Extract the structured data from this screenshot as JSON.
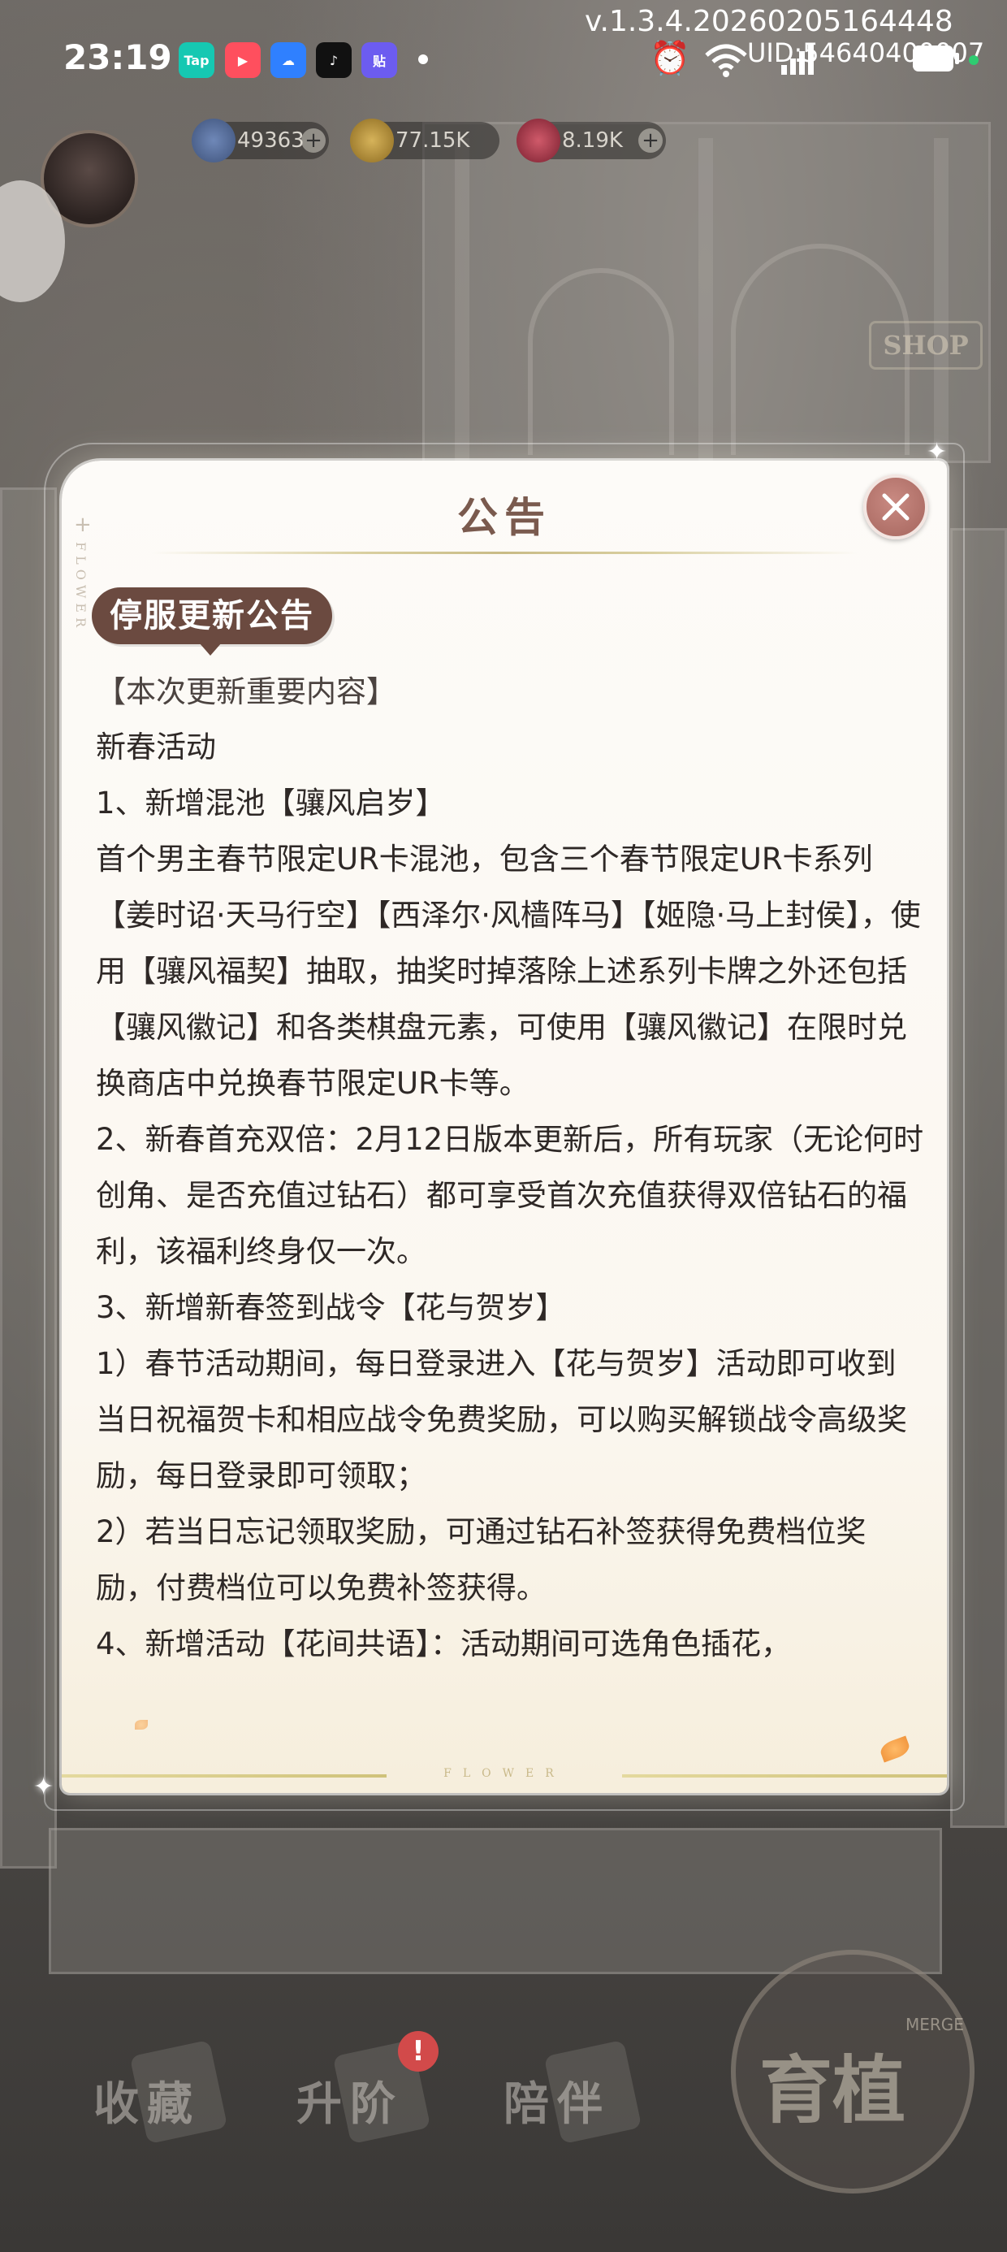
{
  "status_bar": {
    "time": "23:19",
    "version": "v.1.3.4.20260205164448",
    "uid": "UID:54640400007",
    "apps": [
      {
        "name": "taptap-icon",
        "label": "Tap",
        "color": "#16c8b2"
      },
      {
        "name": "video-app-icon",
        "label": "▶",
        "color": "#ff4f5e"
      },
      {
        "name": "cloud-app-icon",
        "label": "☁",
        "color": "#2f80ff"
      },
      {
        "name": "tiktok-icon",
        "label": "♪",
        "color": "#111111"
      },
      {
        "name": "tieba-icon",
        "label": "贴",
        "color": "#6c5cf0"
      }
    ]
  },
  "resources": {
    "energy": "49363",
    "gold": "77.15K",
    "gems": "8.19K"
  },
  "dialog": {
    "title": "公告",
    "side_decoration": "FLOWER",
    "section_tag": "停服更新公告",
    "bottom_decoration": "FLOWER",
    "paragraphs": [
      "【本次更新重要内容】",
      "新春活动",
      "1、新增混池【骧风启岁】",
      "首个男主春节限定UR卡混池，包含三个春节限定UR卡系列【姜时诏·天马行空】【西泽尔·风樯阵马】【姬隐·马上封侯】，使用【骧风福契】抽取，抽奖时掉落除上述系列卡牌之外还包括【骧风徽记】和各类棋盘元素，可使用【骧风徽记】在限时兑换商店中兑换春节限定UR卡等。",
      "2、新春首充双倍：2月12日版本更新后，所有玩家（无论何时创角、是否充值过钻石）都可享受首次充值获得双倍钻石的福利，该福利终身仅一次。",
      "3、新增新春签到战令【花与贺岁】",
      "1）春节活动期间，每日登录进入【花与贺岁】活动即可收到当日祝福贺卡和相应战令免费奖励，可以购买解锁战令高级奖励，每日登录即可领取；",
      "2）若当日忘记领取奖励，可通过钻石补签获得免费档位奖励，付费档位可以免费补签获得。",
      "4、新增活动【花间共语】：活动期间可选角色插花，"
    ]
  },
  "bottom_nav": {
    "collect": "收藏",
    "upgrade": "升阶",
    "accompany": "陪伴",
    "upgrade_badge": "!",
    "grow": "育植",
    "grow_sub": "MERGE",
    "shop": "SHOP"
  },
  "colors": {
    "accent_brown": "#6b4a40",
    "title_color": "#7a5a4e",
    "close_button": "#a5655d",
    "dialog_bg": "#fdfbf8"
  }
}
